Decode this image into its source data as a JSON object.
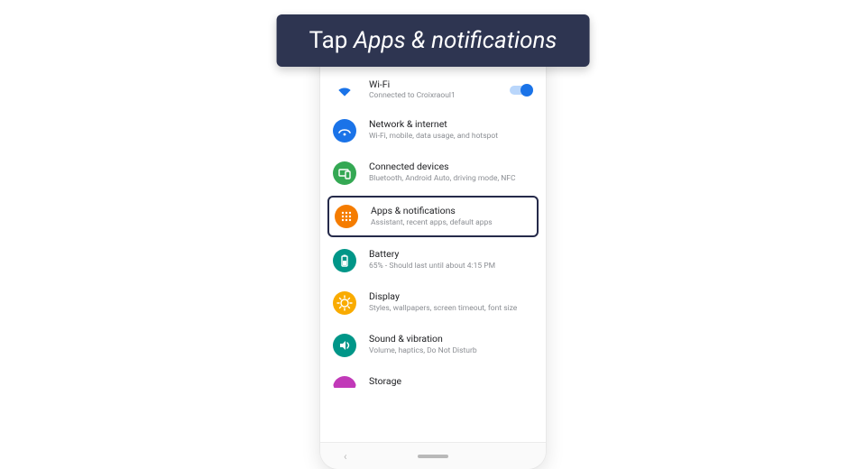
{
  "banner": {
    "prefix": "Tap ",
    "italic": "Apps & notifications"
  },
  "colors": {
    "wifi": "#1a73e8",
    "network": "#1a73e8",
    "connected": "#34a853",
    "apps": "#f57c00",
    "battery": "#009688",
    "display": "#f9ab00",
    "sound": "#009688",
    "storage": "#c139b8"
  },
  "settings": {
    "wifi": {
      "title": "Wi-Fi",
      "sub": "Connected to Croixraoul1"
    },
    "network": {
      "title": "Network & internet",
      "sub": "Wi-Fi, mobile, data usage, and hotspot"
    },
    "connected": {
      "title": "Connected devices",
      "sub": "Bluetooth, Android Auto, driving mode, NFC"
    },
    "apps": {
      "title": "Apps & notifications",
      "sub": "Assistant, recent apps, default apps"
    },
    "battery": {
      "title": "Battery",
      "sub": "65% - Should last until about 4:15 PM"
    },
    "display": {
      "title": "Display",
      "sub": "Styles, wallpapers, screen timeout, font size"
    },
    "sound": {
      "title": "Sound & vibration",
      "sub": "Volume, haptics, Do Not Disturb"
    },
    "storage": {
      "title": "Storage",
      "sub": ""
    }
  },
  "nav": {
    "back": "‹"
  }
}
